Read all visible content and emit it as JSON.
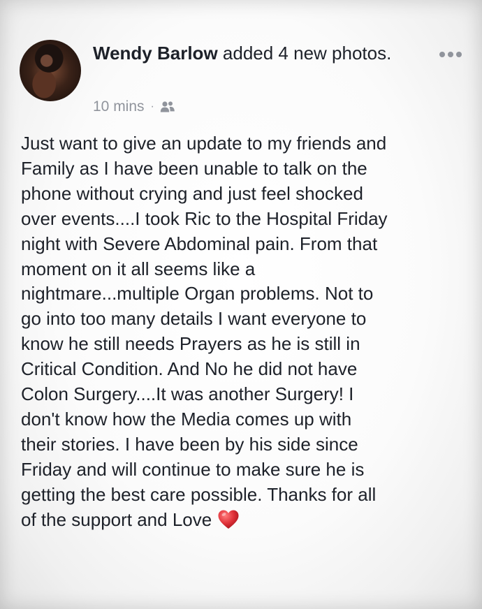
{
  "post": {
    "author_name": "Wendy Barlow",
    "action_text": " added 4 new photos.",
    "timestamp": "10 mins",
    "separator": "·",
    "audience_icon": "friends-icon",
    "more_icon": "more-options-icon",
    "body_lines": [
      "Just want to give an update to my friends and",
      "Family as I have been unable to talk on the",
      "phone without crying and just feel shocked",
      "over events....I took Ric to the Hospital Friday",
      "night with Severe Abdominal pain. From that",
      "moment on it all seems like a",
      "nightmare...multiple Organ  problems. Not to",
      "go into too many details I want everyone to",
      "know he still needs Prayers as he is still in",
      "Critical Condition.  And No he did not have",
      "Colon Surgery....It was another Surgery!  I",
      "don't know how the Media comes up with",
      "their stories. I have been by his side since",
      "Friday and will continue to make sure he is",
      "getting the best care possible.  Thanks for all",
      "of the support and Love"
    ],
    "end_emoji": "red-heart-icon",
    "colors": {
      "text": "#1d2129",
      "meta": "#90949c",
      "heart": "#e0323a"
    }
  }
}
